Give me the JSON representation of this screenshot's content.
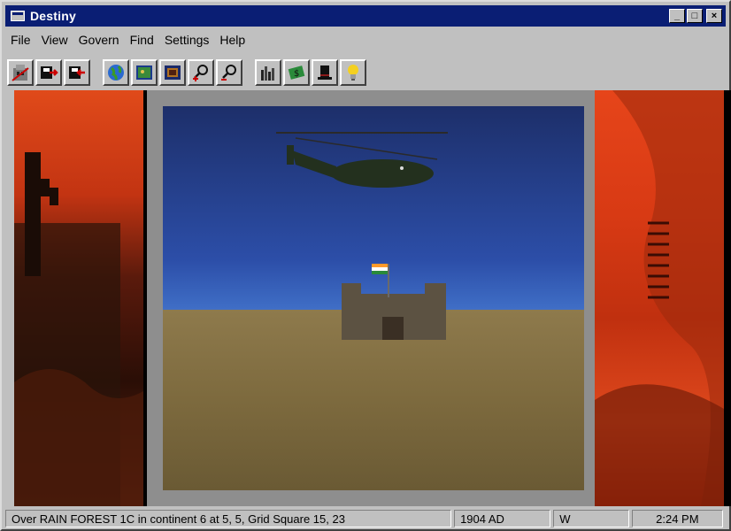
{
  "window": {
    "title": "Destiny",
    "minimize": "_",
    "maximize": "□",
    "close": "×"
  },
  "menu": [
    "File",
    "View",
    "Govern",
    "Find",
    "Settings",
    "Help"
  ],
  "toolbar": {
    "groups": [
      [
        "city-icon",
        "export-icon",
        "import-icon"
      ],
      [
        "globe-icon",
        "map-icon",
        "frame-icon",
        "zoom-in-icon",
        "zoom-out-icon"
      ],
      [
        "city-skyline-icon",
        "money-icon",
        "top-hat-icon",
        "lightbulb-icon"
      ]
    ]
  },
  "scene": {
    "description_elements": [
      "helicopter",
      "fort",
      "flag"
    ],
    "sky_color": "#2c4ea8",
    "ground_color": "#7d6a3e"
  },
  "status": {
    "location": "Over RAIN FOREST 1C in continent 6 at 5, 5, Grid Square 15, 23",
    "year": "1904 AD",
    "direction": "W",
    "time": "2:24 PM"
  }
}
